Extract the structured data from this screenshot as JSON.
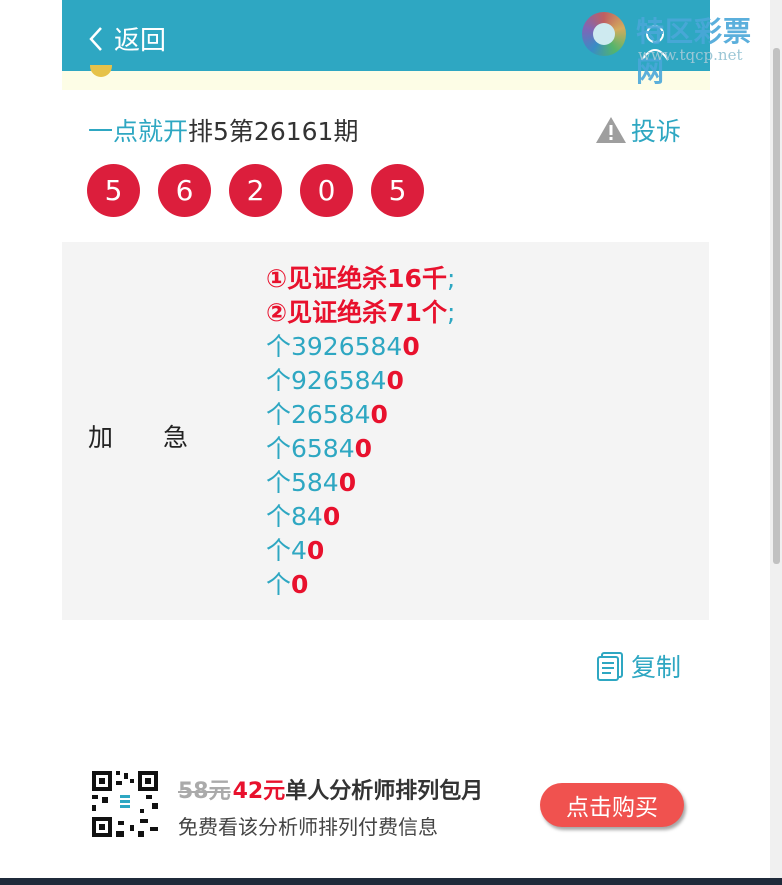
{
  "header": {
    "back_label": "返回",
    "watermark_title": "特区彩票网",
    "watermark_url": "www.tqcp.net"
  },
  "issue": {
    "source": "一点就开",
    "rest": "排5第26161期",
    "complain_label": "投诉"
  },
  "balls": [
    "5",
    "6",
    "2",
    "0",
    "5"
  ],
  "panel": {
    "label_1": "加",
    "label_2": "急",
    "kill1": "①见证绝杀16千",
    "kill2": "②见证绝杀71个",
    "semicolon": ";",
    "rows": [
      {
        "prefix": "个3926584",
        "suffix": "0"
      },
      {
        "prefix": "个926584",
        "suffix": "0"
      },
      {
        "prefix": "个26584",
        "suffix": "0"
      },
      {
        "prefix": "个6584",
        "suffix": "0"
      },
      {
        "prefix": "个584",
        "suffix": "0"
      },
      {
        "prefix": "个84",
        "suffix": "0"
      },
      {
        "prefix": "个4",
        "suffix": "0"
      },
      {
        "prefix": "个",
        "suffix": "0"
      }
    ]
  },
  "copy_label": "复制",
  "promo": {
    "old_price": "58元",
    "new_price": "42元",
    "title": "单人分析师排列包月",
    "subtitle": "免费看该分析师排列付费信息",
    "buy_label": "点击购买"
  },
  "colors": {
    "header_bg": "#2ea7c2",
    "ball_red": "#dc1e3c",
    "accent_red": "#e8112d",
    "link_blue": "#2ea7c2",
    "buy_button": "#f0524f"
  }
}
